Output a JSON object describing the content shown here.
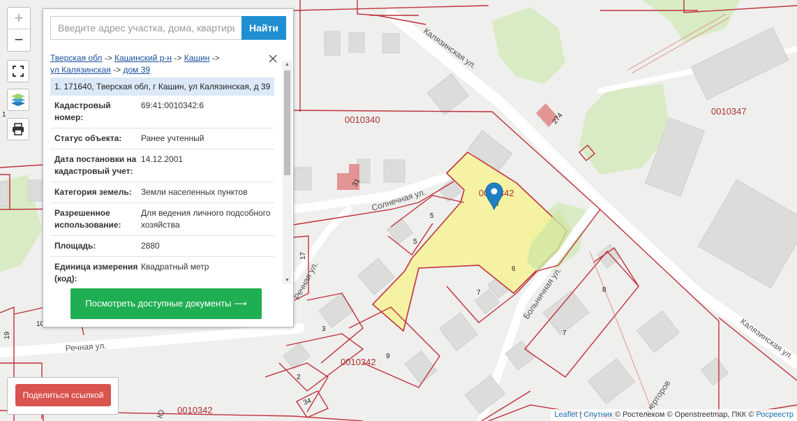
{
  "map": {
    "quarters": [
      "0010340",
      "0010347",
      "0010342",
      "0010342",
      "0010342",
      "0010342"
    ],
    "streets": [
      "Калязинская ул.",
      "Солнечная ул.",
      "Речная ул.",
      "Больничная ул.",
      "Калязинская ул.",
      "Речная ул."
    ],
    "plot_numbers": [
      "5",
      "5",
      "6",
      "7",
      "3",
      "9",
      "2",
      "34",
      "8",
      "7",
      "17",
      "19",
      "10",
      "1",
      "274",
      "31",
      "6"
    ],
    "fragment_labels": [
      "Ю",
      "генерторов"
    ]
  },
  "controls": {
    "zoom_in": "+",
    "zoom_out": "−"
  },
  "search": {
    "placeholder": "Введите адрес участка, дома, квартиры",
    "value": "",
    "button": "Найти"
  },
  "breadcrumb": {
    "items": [
      "Тверская обл",
      "Кашинский р-н",
      "Кашин",
      "ул Калязинская",
      "дом 39"
    ],
    "separator": "->"
  },
  "result": {
    "address": "1. 171640, Тверская обл, г Кашин, ул Калязинская, д 39"
  },
  "properties": [
    {
      "key": "Кадастровый номер:",
      "value": "69:41:0010342:6"
    },
    {
      "key": "Статус объекта:",
      "value": "Ранее учтенный"
    },
    {
      "key": "Дата постановки на кадастровый учет:",
      "value": "14.12.2001"
    },
    {
      "key": "Категория земель:",
      "value": "Земли населенных пунктов"
    },
    {
      "key": "Разрешенное использование:",
      "value": "Для ведения личного подсобного хозяйства"
    },
    {
      "key": "Площадь:",
      "value": "2880"
    },
    {
      "key": "Единица измерения (код):",
      "value": "Квадратный метр"
    }
  ],
  "documents_button": "Посмотреть доступные документы ⟶",
  "share_button": "Поделиться ссылкой",
  "attribution": {
    "leaflet": "Leaflet",
    "sep": " | ",
    "sputnik": "Спутник",
    "rest": " © Ростелеком © Openstreetmap, ПКК © ",
    "rosreestr": "Росреестр"
  },
  "colors": {
    "boundary": "#c0313b",
    "selected_fill": "#f6f29a",
    "search_button": "#1f8fd1",
    "docs_button": "#1fae52",
    "share_button": "#d9534f",
    "marker": "#1f7fc4",
    "green": "#d9ebc4"
  }
}
